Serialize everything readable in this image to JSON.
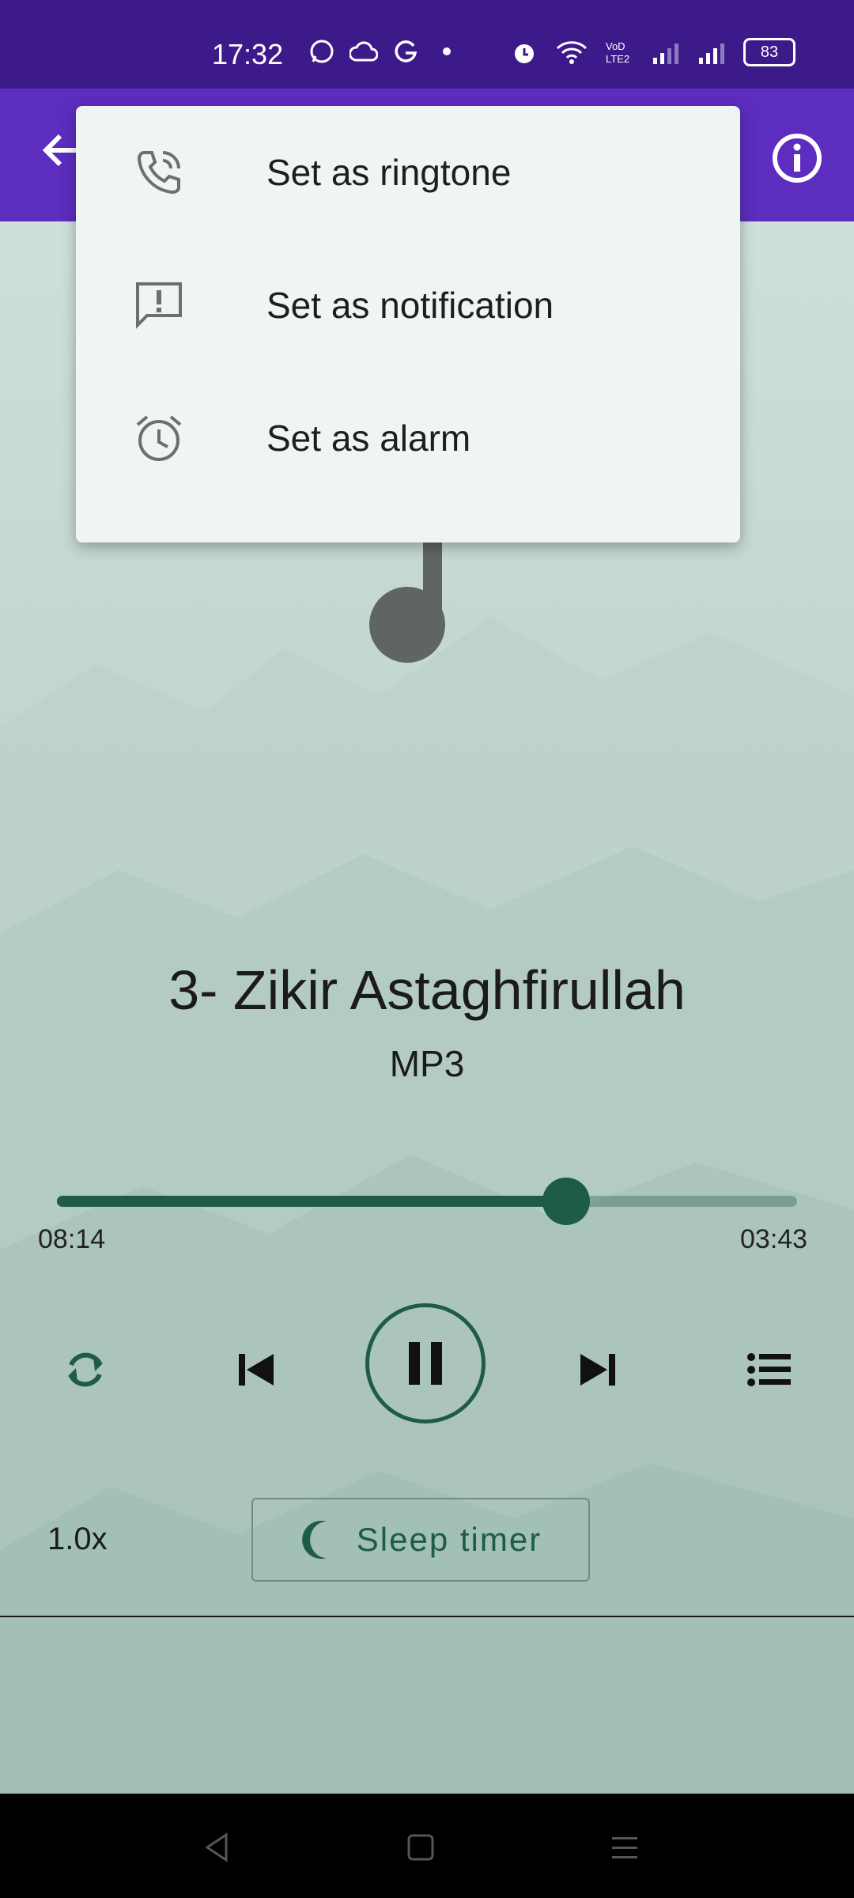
{
  "status_bar": {
    "time": "17:32",
    "battery": "83",
    "icons": [
      "whatsapp-icon",
      "cloud-icon",
      "g-icon",
      "dot-icon",
      "alarm-icon",
      "wifi-icon",
      "volte-icon",
      "signal-icon",
      "signal-icon"
    ]
  },
  "app_bar": {
    "back_icon": "arrow-left-icon",
    "info_icon": "info-icon",
    "color": "#5c2dbe"
  },
  "menu": {
    "items": [
      {
        "label": "Set as ringtone",
        "icon": "phone-ring-icon"
      },
      {
        "label": "Set as notification",
        "icon": "notification-icon"
      },
      {
        "label": "Set as alarm",
        "icon": "alarm-icon"
      }
    ]
  },
  "player": {
    "title": "3- Zikir Astaghfirullah",
    "subtitle": "MP3",
    "elapsed": "08:14",
    "remaining": "03:43",
    "progress": 0.688,
    "speed": "1.0x",
    "sleep_timer_label": "Sleep timer",
    "accent_color": "#1e5c48"
  },
  "nav_bar": {
    "icons": [
      "nav-back-icon",
      "nav-home-icon",
      "nav-menu-icon"
    ]
  }
}
